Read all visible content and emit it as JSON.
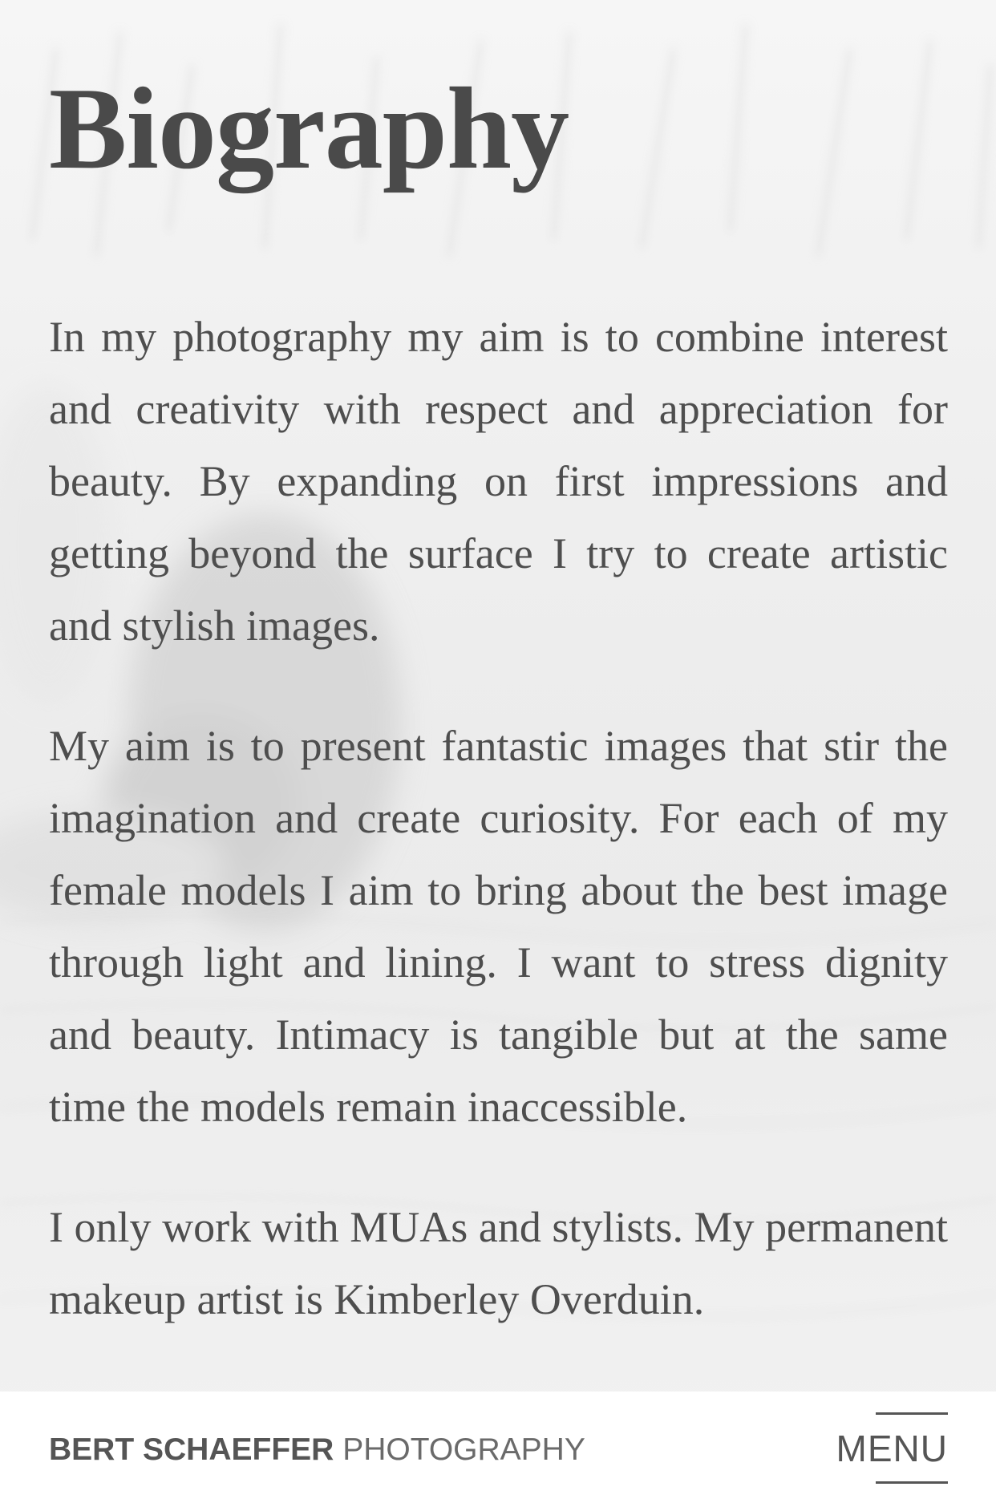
{
  "page": {
    "title": "Biography",
    "paragraphs": [
      "In my photography my aim is to combine interest and creativity with respect and appreciation for beauty. By expanding on first impressions and getting beyond the surface I try to create artistic and stylish images.",
      "My aim is to present fantastic images that stir the imagination and create curiosity. For each of my female models I aim to bring about the best image through light and lining. I want to stress dignity and beauty. Intimacy is tangible but at the same time the models remain inaccessible.",
      "I only work with MUAs and stylists. My permanent makeup artist is Kimberley Overduin."
    ]
  },
  "footer": {
    "brand_bold": "BERT SCHAEFFER",
    "brand_light": "PHOTOGRAPHY",
    "menu_label": "MENU"
  },
  "colors": {
    "text": "#4e4e4e",
    "footer_bg": "#ffffff",
    "background": "#f3f3f3"
  }
}
